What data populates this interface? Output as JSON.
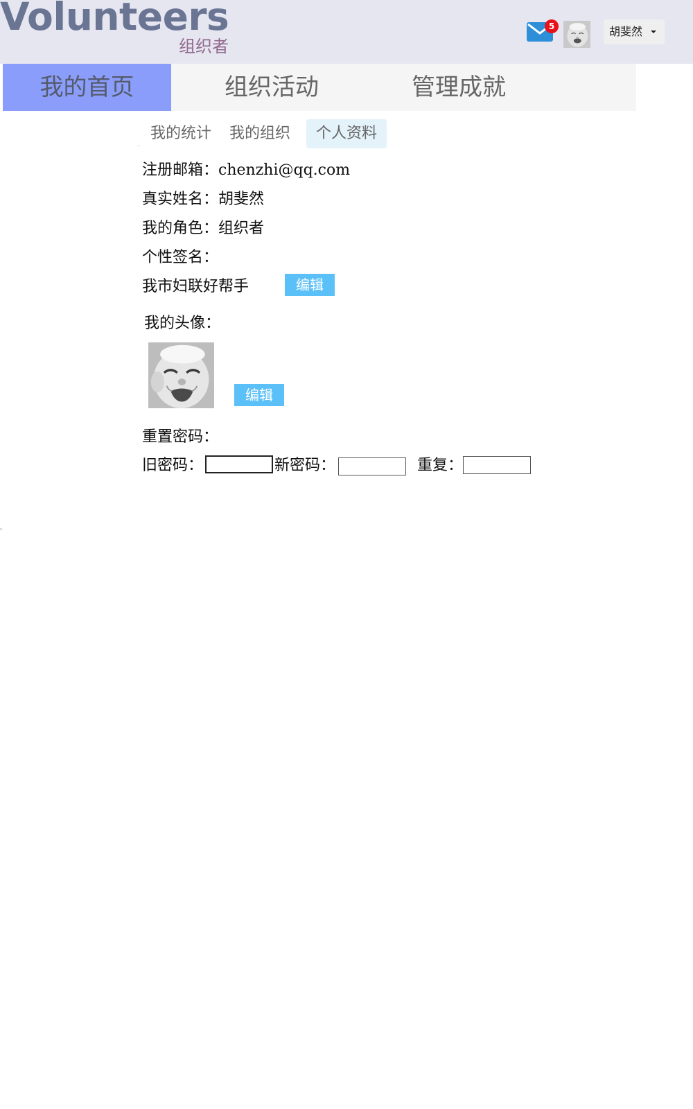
{
  "header": {
    "brand": "Volunteers",
    "role": "组织者",
    "mail_badge": "5",
    "mail_icon": "mail-icon",
    "user_name": "胡斐然"
  },
  "nav": {
    "items": [
      "我的首页",
      "组织活动",
      "管理成就"
    ],
    "active": "我的首页"
  },
  "subtabs": {
    "items": [
      "我的统计",
      "我的组织",
      "个人资料"
    ],
    "active": "个人资料"
  },
  "profile": {
    "email_label": "注册邮箱：",
    "email": "chenzhi@qq.com",
    "name_label": "真实姓名：",
    "name": "胡斐然",
    "role_label": "我的角色：",
    "role": "组织者",
    "signature_label": "个性签名：",
    "signature": "我市妇联好帮手",
    "edit_label": "编辑",
    "avatar_label": "我的头像：",
    "avatar_edit_label": "编辑"
  },
  "password": {
    "section_label": "重置密码：",
    "old_label": "旧密码：",
    "new_label": "新密码：",
    "repeat_label": "重复：",
    "old_value": "",
    "new_value": "",
    "repeat_value": ""
  },
  "colors": {
    "header_bg": "#e6e6f1",
    "brand": "#6a7594",
    "role": "#92698e",
    "nav_active": "#8a9dfb",
    "subtab_active": "#e4f2f9",
    "edit_button": "#5bc0f8",
    "badge": "#e8121b",
    "mail": "#2c8fd8"
  }
}
